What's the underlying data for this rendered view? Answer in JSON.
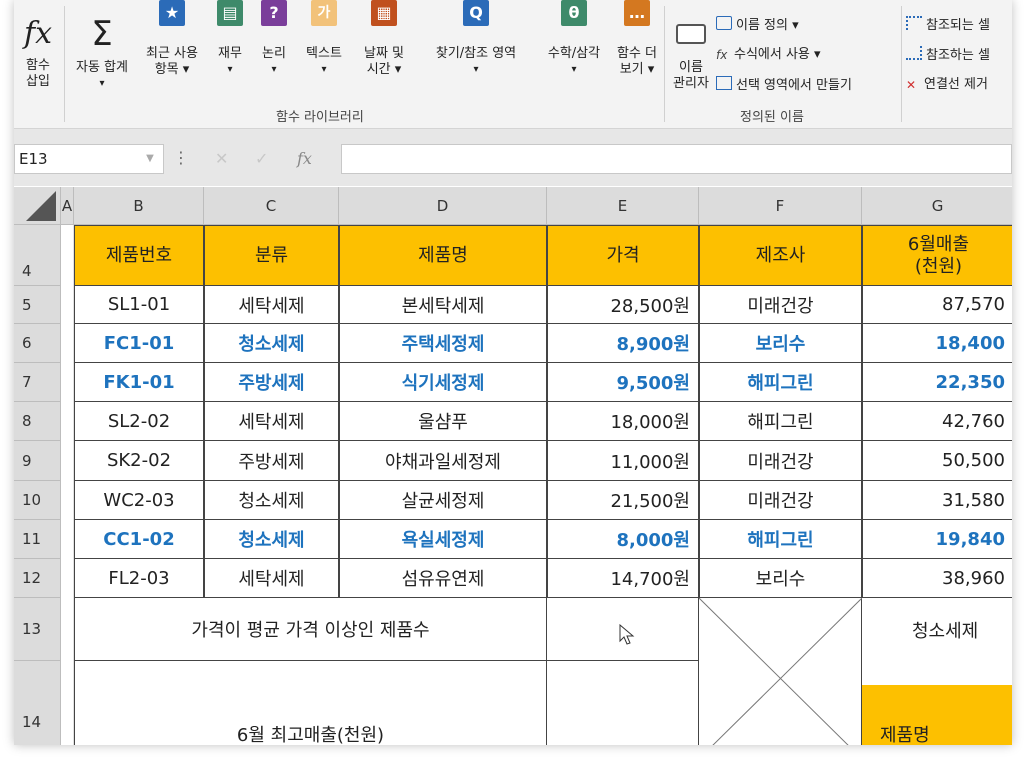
{
  "ribbon": {
    "insert_function": {
      "icon": "fx",
      "label": "함수\n삽입"
    },
    "buttons": [
      {
        "id": "autosum",
        "icon": "Σ",
        "label1": "자동 합계",
        "label2": "▾"
      },
      {
        "id": "recent",
        "icon": "★",
        "label1": "최근 사용",
        "label2": "항목 ▾"
      },
      {
        "id": "financial",
        "icon": "▤",
        "label1": "재무",
        "label2": "▾"
      },
      {
        "id": "logical",
        "icon": "?",
        "label1": "논리",
        "label2": "▾"
      },
      {
        "id": "text",
        "icon": "가",
        "label1": "텍스트",
        "label2": "▾"
      },
      {
        "id": "datetime",
        "icon": "▦",
        "label1": "날짜 및",
        "label2": "시간 ▾"
      },
      {
        "id": "lookup",
        "icon": "Q",
        "label1": "찾기/참조 영역",
        "label2": "▾"
      },
      {
        "id": "math",
        "icon": "θ",
        "label1": "수학/삼각",
        "label2": "▾"
      },
      {
        "id": "more",
        "icon": "…",
        "label1": "함수 더",
        "label2": "보기 ▾"
      }
    ],
    "function_library_label": "함수 라이브러리",
    "name_manager": {
      "label1": "이름",
      "label2": "관리자"
    },
    "define_name": "이름 정의 ▾",
    "use_in_formula": "수식에서 사용 ▾",
    "create_from_selection": "선택 영역에서 만들기",
    "defined_names_label": "정의된 이름",
    "trace_precedents": "참조되는 셀",
    "trace_dependents": "참조하는 셀",
    "remove_arrows": "연결선 제거"
  },
  "formula_bar": {
    "name_box": "E13",
    "fx": "fx",
    "formula": ""
  },
  "columns": [
    "A",
    "B",
    "C",
    "D",
    "E",
    "F",
    "G"
  ],
  "header_row": {
    "row": "4",
    "cells": [
      "제품번호",
      "분류",
      "제품명",
      "가격",
      "제조사",
      "6월매출\n(천원)"
    ]
  },
  "rows": [
    {
      "row": "5",
      "blue": false,
      "cells": [
        "SL1-01",
        "세탁세제",
        "본세탁세제",
        "28,500원",
        "미래건강",
        "87,570"
      ]
    },
    {
      "row": "6",
      "blue": true,
      "cells": [
        "FC1-01",
        "청소세제",
        "주택세정제",
        "8,900원",
        "보리수",
        "18,400"
      ]
    },
    {
      "row": "7",
      "blue": true,
      "cells": [
        "FK1-01",
        "주방세제",
        "식기세정제",
        "9,500원",
        "해피그린",
        "22,350"
      ]
    },
    {
      "row": "8",
      "blue": false,
      "cells": [
        "SL2-02",
        "세탁세제",
        "울샴푸",
        "18,000원",
        "해피그린",
        "42,760"
      ]
    },
    {
      "row": "9",
      "blue": false,
      "cells": [
        "SK2-02",
        "주방세제",
        "야채과일세정제",
        "11,000원",
        "미래건강",
        "50,500"
      ]
    },
    {
      "row": "10",
      "blue": false,
      "cells": [
        "WC2-03",
        "청소세제",
        "살균세정제",
        "21,500원",
        "미래건강",
        "31,580"
      ]
    },
    {
      "row": "11",
      "blue": true,
      "cells": [
        "CC1-02",
        "청소세제",
        "욕실세정제",
        "8,000원",
        "해피그린",
        "19,840"
      ]
    },
    {
      "row": "12",
      "blue": false,
      "cells": [
        "FL2-03",
        "세탁세제",
        "섬유유연제",
        "14,700원",
        "보리수",
        "38,960"
      ]
    }
  ],
  "summary": {
    "row13": "13",
    "row14": "14",
    "label13": "가격이 평균 가격 이상인 제품수",
    "label14": "6월 최고매출(천원)",
    "g13": "청소세제",
    "g14": "제품명"
  }
}
